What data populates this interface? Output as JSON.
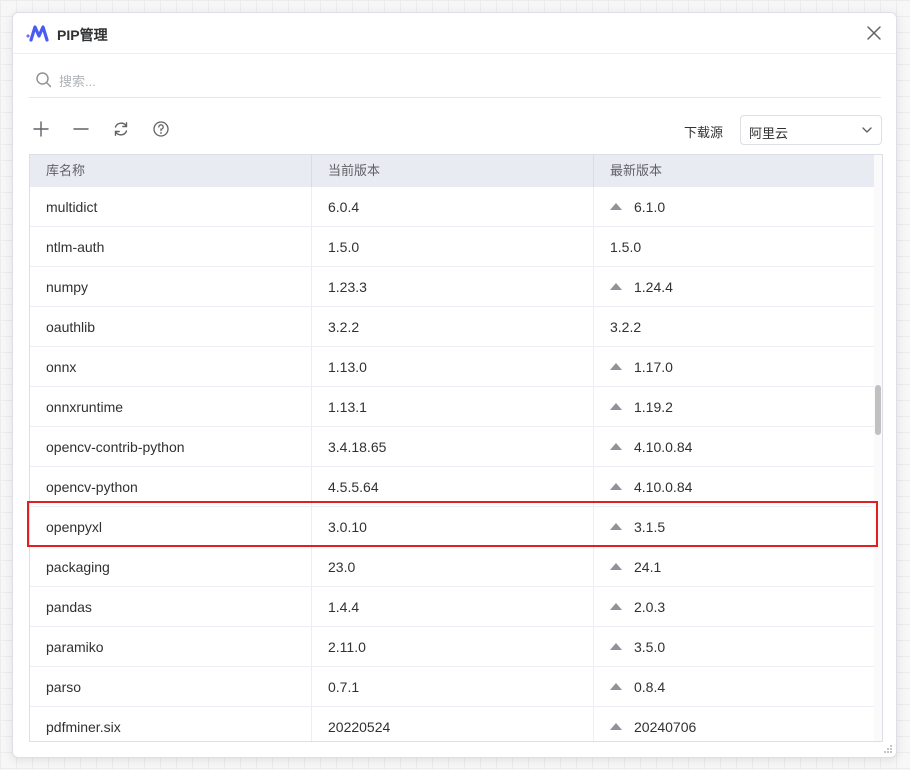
{
  "window": {
    "title": "PIP管理"
  },
  "search": {
    "placeholder": "搜索..."
  },
  "toolbar": {
    "source_label": "下载源",
    "source_value": "阿里云"
  },
  "table": {
    "headers": [
      "库名称",
      "当前版本",
      "最新版本"
    ],
    "rows": [
      {
        "name": "multidict",
        "current": "6.0.4",
        "latest": "6.1.0",
        "upgradable": true
      },
      {
        "name": "ntlm-auth",
        "current": "1.5.0",
        "latest": "1.5.0",
        "upgradable": false
      },
      {
        "name": "numpy",
        "current": "1.23.3",
        "latest": "1.24.4",
        "upgradable": true
      },
      {
        "name": "oauthlib",
        "current": "3.2.2",
        "latest": "3.2.2",
        "upgradable": false
      },
      {
        "name": "onnx",
        "current": "1.13.0",
        "latest": "1.17.0",
        "upgradable": true
      },
      {
        "name": "onnxruntime",
        "current": "1.13.1",
        "latest": "1.19.2",
        "upgradable": true
      },
      {
        "name": "opencv-contrib-python",
        "current": "3.4.18.65",
        "latest": "4.10.0.84",
        "upgradable": true
      },
      {
        "name": "opencv-python",
        "current": "4.5.5.64",
        "latest": "4.10.0.84",
        "upgradable": true
      },
      {
        "name": "openpyxl",
        "current": "3.0.10",
        "latest": "3.1.5",
        "upgradable": true
      },
      {
        "name": "packaging",
        "current": "23.0",
        "latest": "24.1",
        "upgradable": true
      },
      {
        "name": "pandas",
        "current": "1.4.4",
        "latest": "2.0.3",
        "upgradable": true
      },
      {
        "name": "paramiko",
        "current": "2.11.0",
        "latest": "3.5.0",
        "upgradable": true
      },
      {
        "name": "parso",
        "current": "0.7.1",
        "latest": "0.8.4",
        "upgradable": true
      },
      {
        "name": "pdfminer.six",
        "current": "20220524",
        "latest": "20240706",
        "upgradable": true
      }
    ]
  },
  "colors": {
    "accent": "#4a5cf0",
    "highlight": "#e02020",
    "header_bg": "#e9ebf3"
  },
  "icons": [
    "app-logo-icon",
    "close-icon",
    "search-icon",
    "add-icon",
    "remove-icon",
    "refresh-icon",
    "help-icon",
    "chevron-down-icon",
    "upgrade-arrow-icon",
    "resize-grip-icon"
  ]
}
